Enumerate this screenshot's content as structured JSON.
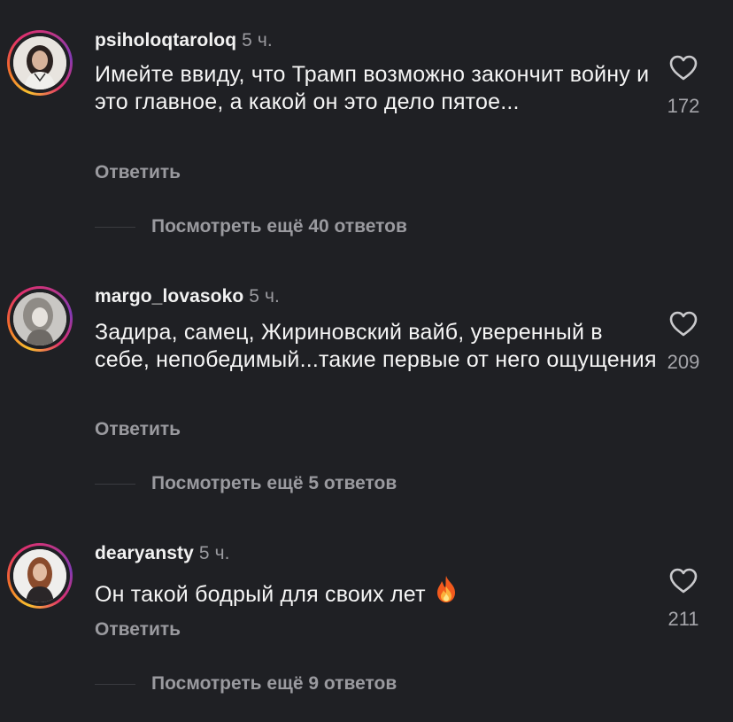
{
  "comments": [
    {
      "username": "psiholoqtaroloq",
      "time": "5 ч.",
      "text": "Имейте ввиду, что Трамп возможно закончит войну и это главное, а какой он это дело пятое...",
      "reply_label": "Ответить",
      "likes": "172",
      "view_replies": "Посмотреть ещё 40 ответов"
    },
    {
      "username": "margo_lovasoko",
      "time": "5 ч.",
      "text": "Задира, самец, Жириновский вайб, уверенный в себе, непобедимый...такие первые от него ощущения",
      "reply_label": "Ответить",
      "likes": "209",
      "view_replies": "Посмотреть ещё 5 ответов"
    },
    {
      "username": "dearyansty",
      "time": "5 ч.",
      "text": "Он такой бодрый для своих лет",
      "emoji": "fire-emoji",
      "reply_label": "Ответить",
      "likes": "211",
      "view_replies": "Посмотреть ещё 9 ответов"
    }
  ],
  "colors": {
    "background": "#1f2024",
    "text": "#f5f5f5",
    "muted": "#9a9a9f"
  }
}
